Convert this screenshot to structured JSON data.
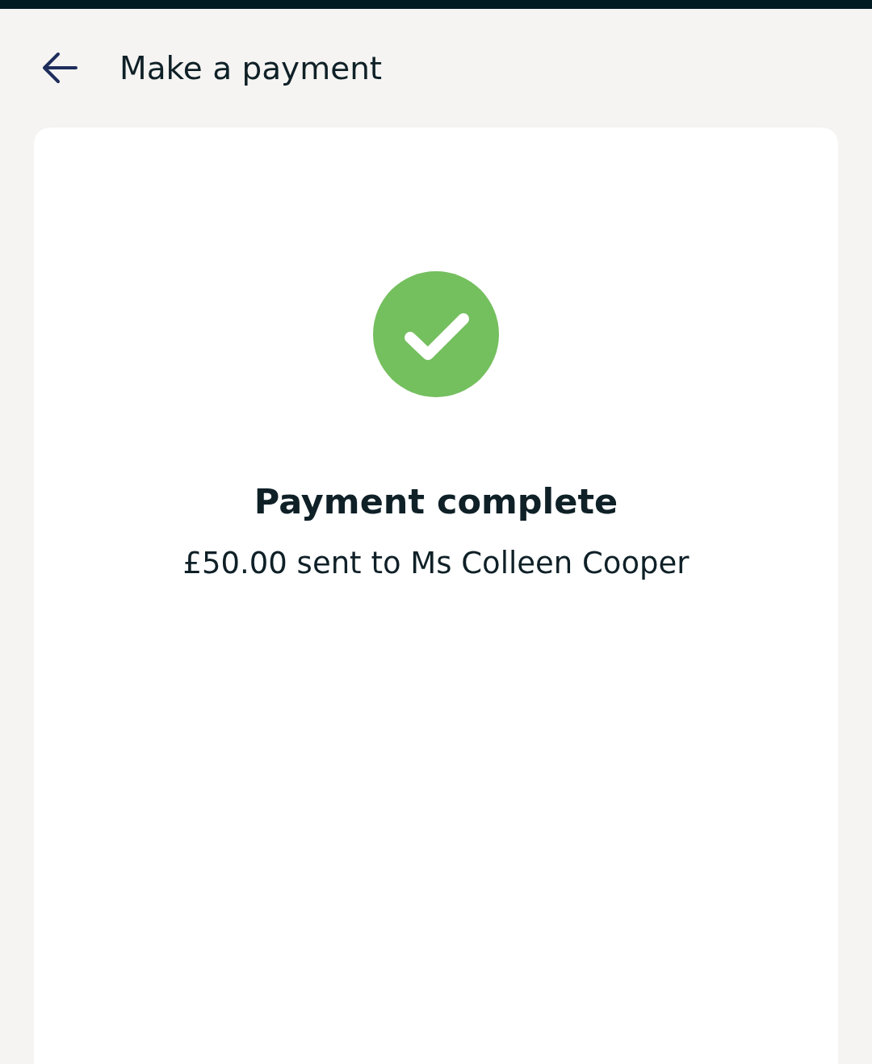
{
  "header": {
    "title": "Make a payment"
  },
  "confirmation": {
    "title": "Payment complete",
    "message": "£50.00 sent to Ms Colleen Cooper"
  }
}
